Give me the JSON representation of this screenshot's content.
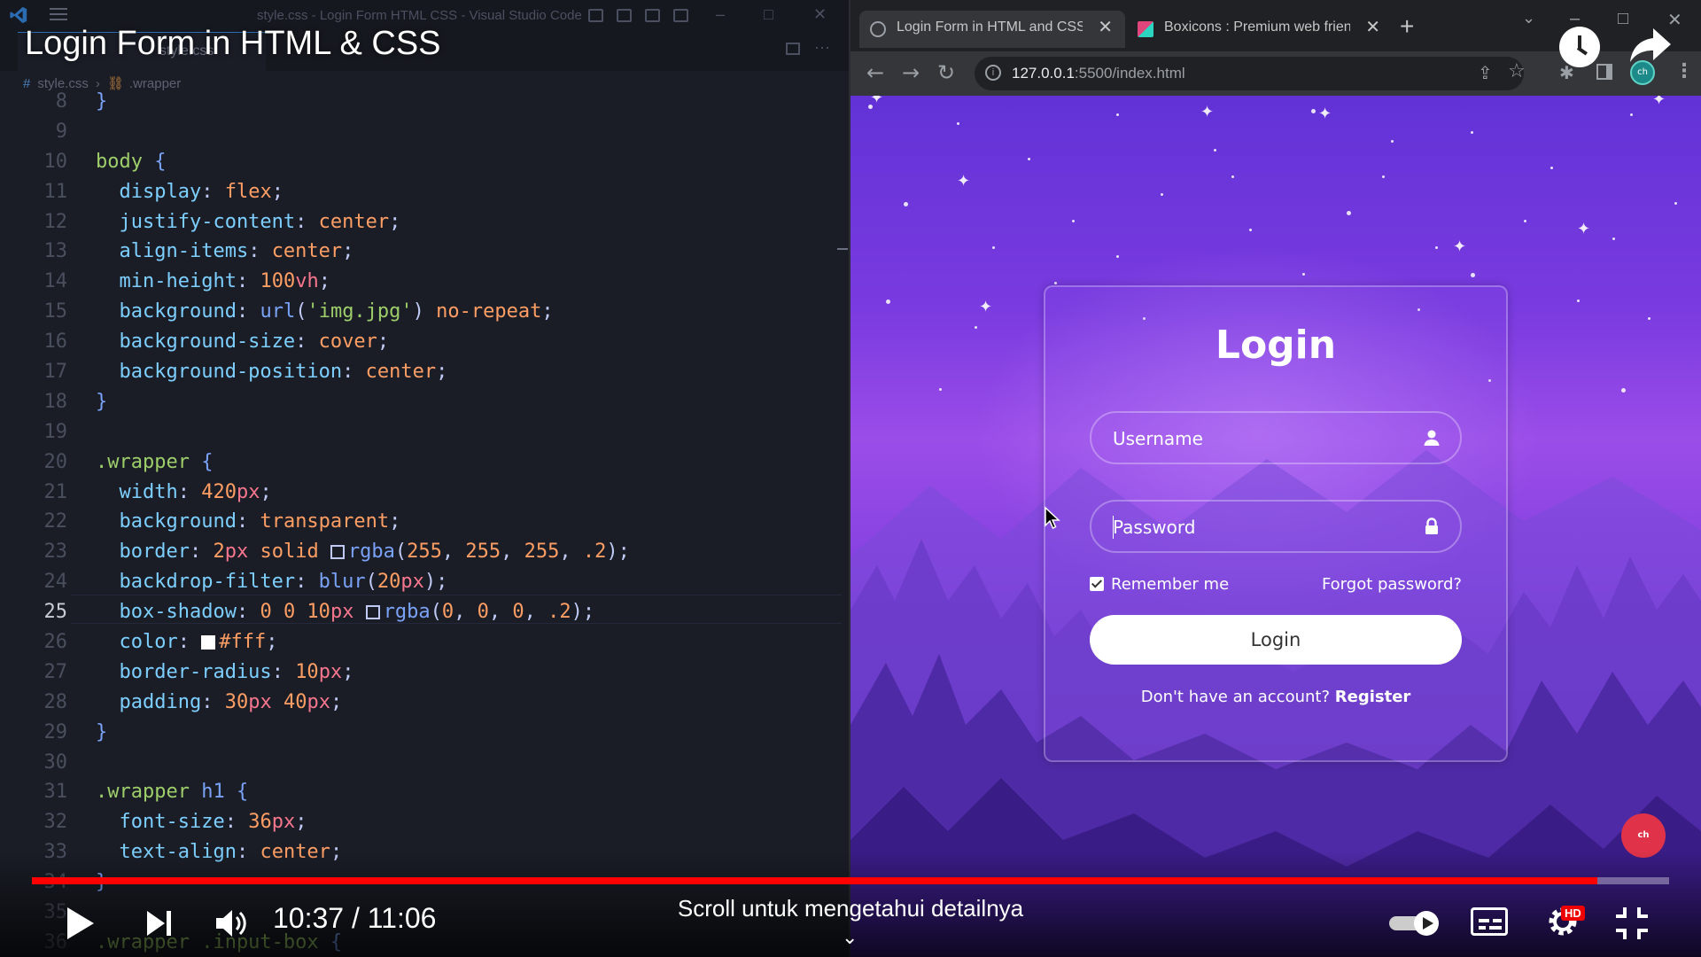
{
  "video": {
    "title": "Login Form in HTML & CSS",
    "time": "10:37 / 11:06",
    "progress_fraction": 0.956,
    "scroll_hint": "Scroll untuk mengetahui detailnya",
    "hd_badge": "HD"
  },
  "vscode": {
    "window_title": "style.css - Login Form HTML CSS - Visual Studio Code",
    "tab_label": "style.css",
    "breadcrumb": {
      "file": "style.css",
      "symbol": ".wrapper"
    },
    "active_line": 25,
    "lines": [
      {
        "n": 8,
        "tokens": [
          {
            "t": "}",
            "c": "brace"
          }
        ]
      },
      {
        "n": 9,
        "tokens": []
      },
      {
        "n": 10,
        "tokens": [
          {
            "t": "body",
            "c": "sel"
          },
          {
            "t": " {",
            "c": "brace"
          }
        ]
      },
      {
        "n": 11,
        "tokens": [
          {
            "t": "  display",
            "c": "prop"
          },
          {
            "t": ": ",
            "c": "punc"
          },
          {
            "t": "flex",
            "c": "val"
          },
          {
            "t": ";",
            "c": "punc"
          }
        ]
      },
      {
        "n": 12,
        "tokens": [
          {
            "t": "  justify-content",
            "c": "prop"
          },
          {
            "t": ": ",
            "c": "punc"
          },
          {
            "t": "center",
            "c": "val"
          },
          {
            "t": ";",
            "c": "punc"
          }
        ]
      },
      {
        "n": 13,
        "tokens": [
          {
            "t": "  align-items",
            "c": "prop"
          },
          {
            "t": ": ",
            "c": "punc"
          },
          {
            "t": "center",
            "c": "val"
          },
          {
            "t": ";",
            "c": "punc"
          }
        ]
      },
      {
        "n": 14,
        "tokens": [
          {
            "t": "  min-height",
            "c": "prop"
          },
          {
            "t": ": ",
            "c": "punc"
          },
          {
            "t": "100",
            "c": "num"
          },
          {
            "t": "vh",
            "c": "unit"
          },
          {
            "t": ";",
            "c": "punc"
          }
        ]
      },
      {
        "n": 15,
        "tokens": [
          {
            "t": "  background",
            "c": "prop"
          },
          {
            "t": ": ",
            "c": "punc"
          },
          {
            "t": "url",
            "c": "fn"
          },
          {
            "t": "(",
            "c": "punc"
          },
          {
            "t": "'img.jpg'",
            "c": "str"
          },
          {
            "t": ")",
            "c": "punc"
          },
          {
            "t": " no-repeat",
            "c": "val"
          },
          {
            "t": ";",
            "c": "punc"
          }
        ]
      },
      {
        "n": 16,
        "tokens": [
          {
            "t": "  background-size",
            "c": "prop"
          },
          {
            "t": ": ",
            "c": "punc"
          },
          {
            "t": "cover",
            "c": "val"
          },
          {
            "t": ";",
            "c": "punc"
          }
        ]
      },
      {
        "n": 17,
        "tokens": [
          {
            "t": "  background-position",
            "c": "prop"
          },
          {
            "t": ": ",
            "c": "punc"
          },
          {
            "t": "center",
            "c": "val"
          },
          {
            "t": ";",
            "c": "punc"
          }
        ]
      },
      {
        "n": 18,
        "tokens": [
          {
            "t": "}",
            "c": "brace"
          }
        ]
      },
      {
        "n": 19,
        "tokens": []
      },
      {
        "n": 20,
        "tokens": [
          {
            "t": ".wrapper",
            "c": "sel"
          },
          {
            "t": " {",
            "c": "brace"
          }
        ]
      },
      {
        "n": 21,
        "tokens": [
          {
            "t": "  width",
            "c": "prop"
          },
          {
            "t": ": ",
            "c": "punc"
          },
          {
            "t": "420",
            "c": "num"
          },
          {
            "t": "px",
            "c": "unit"
          },
          {
            "t": ";",
            "c": "punc"
          }
        ]
      },
      {
        "n": 22,
        "tokens": [
          {
            "t": "  background",
            "c": "prop"
          },
          {
            "t": ": ",
            "c": "punc"
          },
          {
            "t": "transparent",
            "c": "val"
          },
          {
            "t": ";",
            "c": "punc"
          }
        ]
      },
      {
        "n": 23,
        "tokens": [
          {
            "t": "  border",
            "c": "prop"
          },
          {
            "t": ": ",
            "c": "punc"
          },
          {
            "t": "2",
            "c": "num"
          },
          {
            "t": "px",
            "c": "unit"
          },
          {
            "t": " solid ",
            "c": "val"
          },
          {
            "t": "",
            "c": "swatch"
          },
          {
            "t": "rgba",
            "c": "fn"
          },
          {
            "t": "(",
            "c": "punc"
          },
          {
            "t": "255",
            "c": "num"
          },
          {
            "t": ", ",
            "c": "punc"
          },
          {
            "t": "255",
            "c": "num"
          },
          {
            "t": ", ",
            "c": "punc"
          },
          {
            "t": "255",
            "c": "num"
          },
          {
            "t": ", ",
            "c": "punc"
          },
          {
            "t": ".2",
            "c": "num"
          },
          {
            "t": ");",
            "c": "punc"
          }
        ]
      },
      {
        "n": 24,
        "tokens": [
          {
            "t": "  backdrop-filter",
            "c": "prop"
          },
          {
            "t": ": ",
            "c": "punc"
          },
          {
            "t": "blur",
            "c": "fn"
          },
          {
            "t": "(",
            "c": "punc"
          },
          {
            "t": "20",
            "c": "num"
          },
          {
            "t": "px",
            "c": "unit"
          },
          {
            "t": ");",
            "c": "punc"
          }
        ]
      },
      {
        "n": 25,
        "tokens": [
          {
            "t": "  box-shadow",
            "c": "prop"
          },
          {
            "t": ": ",
            "c": "punc"
          },
          {
            "t": "0 0 10",
            "c": "num"
          },
          {
            "t": "px ",
            "c": "unit"
          },
          {
            "t": "",
            "c": "swatch"
          },
          {
            "t": "rgba",
            "c": "fn"
          },
          {
            "t": "(",
            "c": "punc"
          },
          {
            "t": "0",
            "c": "num"
          },
          {
            "t": ", ",
            "c": "punc"
          },
          {
            "t": "0",
            "c": "num"
          },
          {
            "t": ", ",
            "c": "punc"
          },
          {
            "t": "0",
            "c": "num"
          },
          {
            "t": ", ",
            "c": "punc"
          },
          {
            "t": ".2",
            "c": "num"
          },
          {
            "t": ");",
            "c": "punc"
          }
        ]
      },
      {
        "n": 26,
        "tokens": [
          {
            "t": "  color",
            "c": "prop"
          },
          {
            "t": ": ",
            "c": "punc"
          },
          {
            "t": "",
            "c": "swatch-white"
          },
          {
            "t": "#fff",
            "c": "val"
          },
          {
            "t": ";",
            "c": "punc"
          }
        ]
      },
      {
        "n": 27,
        "tokens": [
          {
            "t": "  border-radius",
            "c": "prop"
          },
          {
            "t": ": ",
            "c": "punc"
          },
          {
            "t": "10",
            "c": "num"
          },
          {
            "t": "px",
            "c": "unit"
          },
          {
            "t": ";",
            "c": "punc"
          }
        ]
      },
      {
        "n": 28,
        "tokens": [
          {
            "t": "  padding",
            "c": "prop"
          },
          {
            "t": ": ",
            "c": "punc"
          },
          {
            "t": "30",
            "c": "num"
          },
          {
            "t": "px ",
            "c": "unit"
          },
          {
            "t": "40",
            "c": "num"
          },
          {
            "t": "px",
            "c": "unit"
          },
          {
            "t": ";",
            "c": "punc"
          }
        ]
      },
      {
        "n": 29,
        "tokens": [
          {
            "t": "}",
            "c": "brace"
          }
        ]
      },
      {
        "n": 30,
        "tokens": []
      },
      {
        "n": 31,
        "tokens": [
          {
            "t": ".wrapper ",
            "c": "sel"
          },
          {
            "t": "h1",
            "c": "fn"
          },
          {
            "t": " {",
            "c": "brace"
          }
        ]
      },
      {
        "n": 32,
        "tokens": [
          {
            "t": "  font-size",
            "c": "prop"
          },
          {
            "t": ": ",
            "c": "punc"
          },
          {
            "t": "36",
            "c": "num"
          },
          {
            "t": "px",
            "c": "unit"
          },
          {
            "t": ";",
            "c": "punc"
          }
        ]
      },
      {
        "n": 33,
        "tokens": [
          {
            "t": "  text-align",
            "c": "prop"
          },
          {
            "t": ": ",
            "c": "punc"
          },
          {
            "t": "center",
            "c": "val"
          },
          {
            "t": ";",
            "c": "punc"
          }
        ]
      },
      {
        "n": 34,
        "tokens": [
          {
            "t": "}",
            "c": "brace"
          }
        ]
      },
      {
        "n": 35,
        "tokens": []
      },
      {
        "n": 36,
        "tokens": [
          {
            "t": ".wrapper .input-box",
            "c": "sel"
          },
          {
            "t": " {",
            "c": "brace"
          }
        ]
      }
    ]
  },
  "browser": {
    "tabs": [
      {
        "label": "Login Form in HTML and CSS | C",
        "active": true
      },
      {
        "label": "Boxicons : Premium web friendly",
        "active": false
      }
    ],
    "new_tab": "+",
    "url_host": "127.0.0.1",
    "url_rest": ":5500/index.html",
    "profile": "ch"
  },
  "login_page": {
    "title": "Login",
    "username_placeholder": "Username",
    "password_placeholder": "Password",
    "remember_label": "Remember me",
    "remember_checked": true,
    "forgot_label": "Forgot password?",
    "login_button": "Login",
    "register_prompt": "Don't have an account?",
    "register_link": "Register",
    "subscribe_badge": "ch"
  },
  "colors": {
    "editor_bg": "#1a1d26",
    "browser_chrome": "#202124",
    "yt_progress": "#ff0000",
    "login_bg_top": "#6232d6",
    "login_bg_bottom": "#3d1f94"
  }
}
